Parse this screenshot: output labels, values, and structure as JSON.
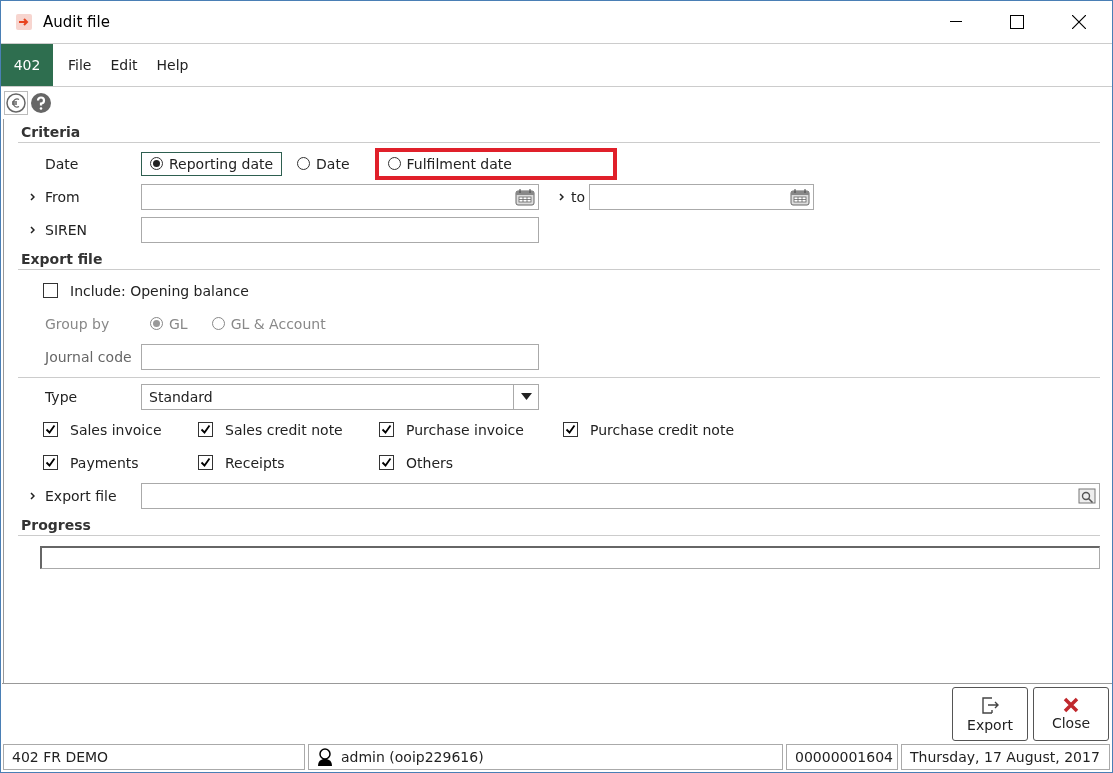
{
  "window": {
    "title": "Audit file"
  },
  "company_badge": "402",
  "menu": [
    {
      "label": "File"
    },
    {
      "label": "Edit"
    },
    {
      "label": "Help"
    }
  ],
  "criteria": {
    "heading": "Criteria",
    "date_label": "Date",
    "date_options": [
      {
        "label": "Reporting date",
        "selected": true,
        "highlighted": false
      },
      {
        "label": "Date",
        "selected": false,
        "highlighted": false
      },
      {
        "label": "Fulfilment date",
        "selected": false,
        "highlighted": true
      }
    ],
    "from_label": "From",
    "to_label": "to",
    "siren_label": "SIREN"
  },
  "export": {
    "heading": "Export file",
    "opening_balance": {
      "label": "Include: Opening balance",
      "checked": false
    },
    "group_by_label": "Group by",
    "group_by_disabled": true,
    "group_options": [
      {
        "label": "GL",
        "selected": true
      },
      {
        "label": "GL & Account",
        "selected": false
      }
    ],
    "journal_label": "Journal code"
  },
  "type": {
    "label": "Type",
    "value": "Standard"
  },
  "document_types": [
    [
      {
        "label": "Sales invoice",
        "checked": true
      },
      {
        "label": "Sales credit note",
        "checked": true
      },
      {
        "label": "Purchase invoice",
        "checked": true
      },
      {
        "label": "Purchase credit note",
        "checked": true
      }
    ],
    [
      {
        "label": "Payments",
        "checked": true
      },
      {
        "label": "Receipts",
        "checked": true
      },
      {
        "label": "Others",
        "checked": true
      }
    ]
  ],
  "export_file_label": "Export file",
  "progress": {
    "heading": "Progress",
    "level": 0
  },
  "buttons": [
    {
      "kind": "export",
      "label": "Export"
    },
    {
      "kind": "close",
      "label": "Close"
    }
  ],
  "status_bar": {
    "company": "402 FR DEMO",
    "user": "admin (ooip229616)",
    "number": "00000001604",
    "date": "Thursday, 17 August, 2017"
  }
}
